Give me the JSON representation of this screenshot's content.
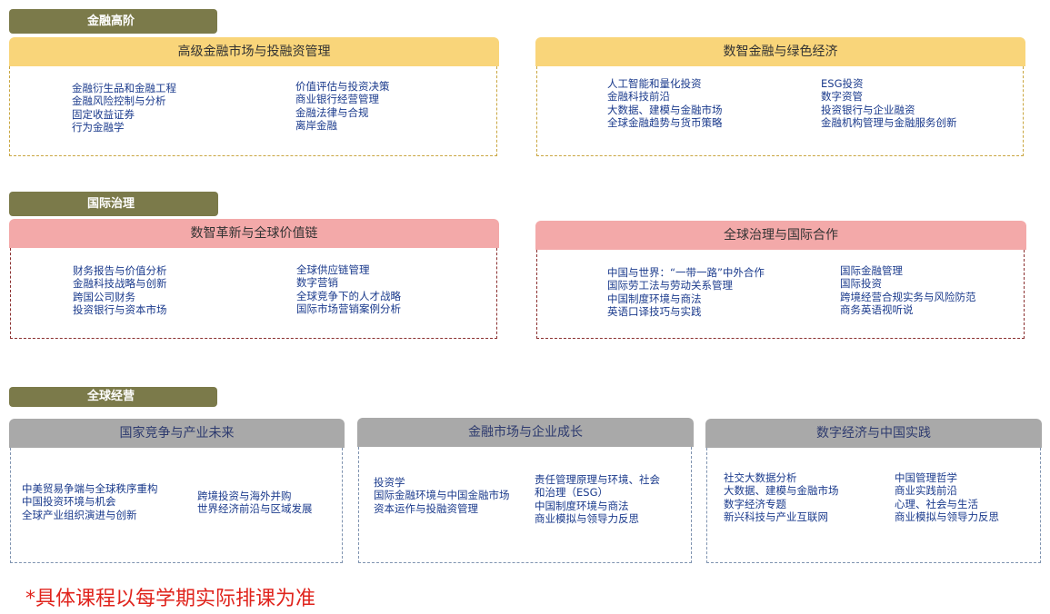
{
  "sections": [
    {
      "tag": "金融高阶",
      "cards": [
        {
          "title": "高级金融市场与投融资管理",
          "left": [
            "金融衍生品和金融工程",
            "金融风险控制与分析",
            "固定收益证券",
            "行为金融学"
          ],
          "right": [
            "价值评估与投资决策",
            "商业银行经营管理",
            "金融法律与合规",
            "离岸金融"
          ]
        },
        {
          "title": "数智金融与绿色经济",
          "left": [
            "人工智能和量化投资",
            "金融科技前沿",
            "大数据、建模与金融市场",
            "全球金融趋势与货币策略"
          ],
          "right": [
            "ESG投资",
            "数字资管",
            "投资银行与企业融资",
            "金融机构管理与金融服务创新"
          ]
        }
      ]
    },
    {
      "tag": "国际治理",
      "cards": [
        {
          "title": "数智革新与全球价值链",
          "left": [
            "财务报告与价值分析",
            "金融科技战略与创新",
            "跨国公司财务",
            "投资银行与资本市场"
          ],
          "right": [
            "全球供应链管理",
            "数字营销",
            "全球竞争下的人才战略",
            "国际市场营销案例分析"
          ]
        },
        {
          "title": "全球治理与国际合作",
          "left": [
            "中国与世界：“一带一路”中外合作",
            "国际劳工法与劳动关系管理",
            "中国制度环境与商法",
            "英语口译技巧与实践"
          ],
          "right": [
            "国际金融管理",
            "国际投资",
            "跨境经营合规实务与风险防范",
            "商务英语视听说"
          ]
        }
      ]
    },
    {
      "tag": "全球经营",
      "cards": [
        {
          "title": "国家竞争与产业未来",
          "left": [
            "中美贸易争端与全球秩序重构",
            "中国投资环境与机会",
            "全球产业组织演进与创新"
          ],
          "right": [
            "跨境投资与海外并购",
            "世界经济前沿与区域发展"
          ]
        },
        {
          "title": "金融市场与企业成长",
          "left": [
            "投资学",
            "国际金融环境与中国金融市场",
            "资本运作与投融资管理"
          ],
          "right": [
            "责任管理原理与环境、社会",
            "和治理（ESG）",
            "中国制度环境与商法",
            "商业模拟与领导力反思"
          ]
        },
        {
          "title": "数字经济与中国实践",
          "left": [
            "社交大数据分析",
            "大数据、建模与金融市场",
            "数字经济专题",
            "新兴科技与产业互联网"
          ],
          "right": [
            "中国管理哲学",
            "商业实践前沿",
            "心理、社会与生活",
            "商业模拟与领导力反思"
          ]
        }
      ]
    }
  ],
  "note": "*具体课程以每学期实际排课为准",
  "colors": {
    "tag_bg": "#7b7a4a",
    "yellow": "#f9d57a",
    "pink": "#f3a9a9",
    "gray": "#a9a9a9",
    "note": "#e0241d"
  }
}
